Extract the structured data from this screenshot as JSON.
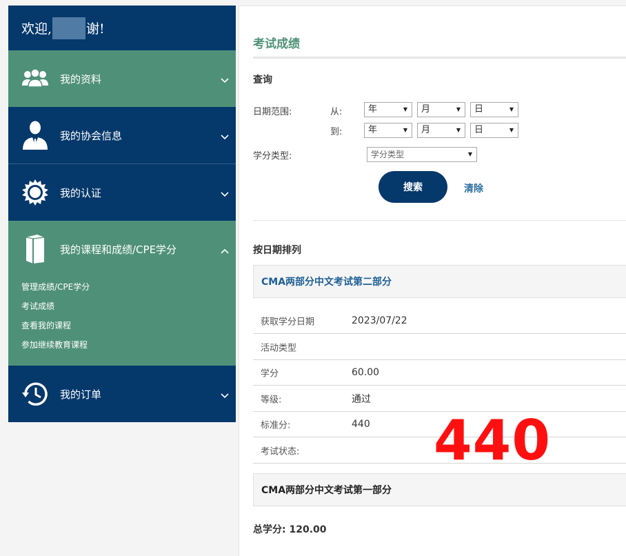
{
  "sidebar": {
    "welcome_prefix": "欢迎,",
    "welcome_suffix": "谢!",
    "items": [
      {
        "label": "我的资料",
        "icon": "users-icon"
      },
      {
        "label": "我的协会信息",
        "icon": "person-suit-icon"
      },
      {
        "label": "我的认证",
        "icon": "certificate-badge-icon"
      },
      {
        "label": "我的课程和成绩/CPE学分",
        "icon": "book-icon"
      },
      {
        "label": "我的订单",
        "icon": "history-clock-icon"
      }
    ],
    "submenu": [
      "管理成绩/CPE学分",
      "考试成绩",
      "查看我的课程",
      "参加继续教育课程"
    ]
  },
  "main": {
    "page_title": "考试成绩",
    "query": {
      "section_title": "查询",
      "date_range_label": "日期范围:",
      "from_label": "从:",
      "to_label": "到:",
      "year": "年",
      "month": "月",
      "day": "日",
      "credit_type_label": "学分类型:",
      "credit_type_value": "学分类型",
      "search_button": "搜索",
      "clear_link": "清除"
    },
    "results": {
      "section_title": "按日期排列",
      "exam1": {
        "title": "CMA两部分中文考试第二部分",
        "rows": [
          {
            "label": "获取学分日期",
            "value": "2023/07/22"
          },
          {
            "label": "活动类型",
            "value": ""
          },
          {
            "label": "学分",
            "value": "60.00"
          },
          {
            "label": "等级:",
            "value": "通过"
          },
          {
            "label": "标准分:",
            "value": "440"
          },
          {
            "label": "考试状态:",
            "value": ""
          }
        ]
      },
      "exam2": {
        "title": "CMA两部分中文考试第一部分"
      },
      "total": "总学分: 120.00"
    },
    "annotation": "440"
  },
  "colors": {
    "navy": "#05386b",
    "green": "#4f9178",
    "annotation_red": "#ff1010",
    "link_blue": "#1d5f95"
  }
}
